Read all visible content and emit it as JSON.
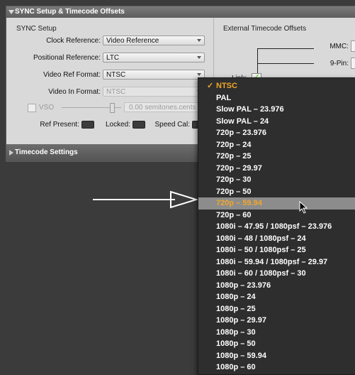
{
  "panel": {
    "title": "SYNC Setup & Timecode Offsets",
    "sync_setup_label": "SYNC Setup",
    "external_tc_label": "External Timecode Offsets",
    "clock_ref_label": "Clock Reference:",
    "clock_ref_value": "Video Reference",
    "positional_ref_label": "Positional Reference:",
    "positional_ref_value": "LTC",
    "video_ref_format_label": "Video Ref Format:",
    "video_ref_format_value": "NTSC",
    "video_in_format_label": "Video In Format:",
    "video_in_format_value": "NTSC",
    "vso_label": "VSO",
    "vso_value": "0.00",
    "vso_units": "semitones.cents",
    "ref_present_label": "Ref Present:",
    "locked_label": "Locked:",
    "speed_cal_label": "Speed Cal:",
    "mmc_label": "MMC:",
    "nine_pin_label": "9-Pin:",
    "link_label": "Link:",
    "timecode_settings_label": "Timecode Settings"
  },
  "menu": {
    "items": [
      {
        "label": "NTSC",
        "checked": true
      },
      {
        "label": "PAL"
      },
      {
        "label": "Slow PAL – 23.976"
      },
      {
        "label": "Slow PAL – 24"
      },
      {
        "label": "720p – 23.976"
      },
      {
        "label": "720p – 24"
      },
      {
        "label": "720p – 25"
      },
      {
        "label": "720p – 29.97"
      },
      {
        "label": "720p – 30"
      },
      {
        "label": "720p – 50"
      },
      {
        "label": "720p – 59.94",
        "highlighted": true
      },
      {
        "label": "720p – 60"
      },
      {
        "label": "1080i – 47.95 / 1080psf – 23.976"
      },
      {
        "label": "1080i – 48 / 1080psf – 24"
      },
      {
        "label": "1080i – 50 / 1080psf – 25"
      },
      {
        "label": "1080i – 59.94 / 1080psf – 29.97"
      },
      {
        "label": "1080i – 60 / 1080psf – 30"
      },
      {
        "label": "1080p – 23.976"
      },
      {
        "label": "1080p – 24"
      },
      {
        "label": "1080p – 25"
      },
      {
        "label": "1080p – 29.97"
      },
      {
        "label": "1080p – 30"
      },
      {
        "label": "1080p – 50"
      },
      {
        "label": "1080p – 59.94"
      },
      {
        "label": "1080p – 60"
      }
    ]
  },
  "colors": {
    "accent": "#f0a62b",
    "menu_bg": "#2e2e2e",
    "highlight_bg": "#8c8c8c",
    "led_green": "#6fd63a"
  }
}
